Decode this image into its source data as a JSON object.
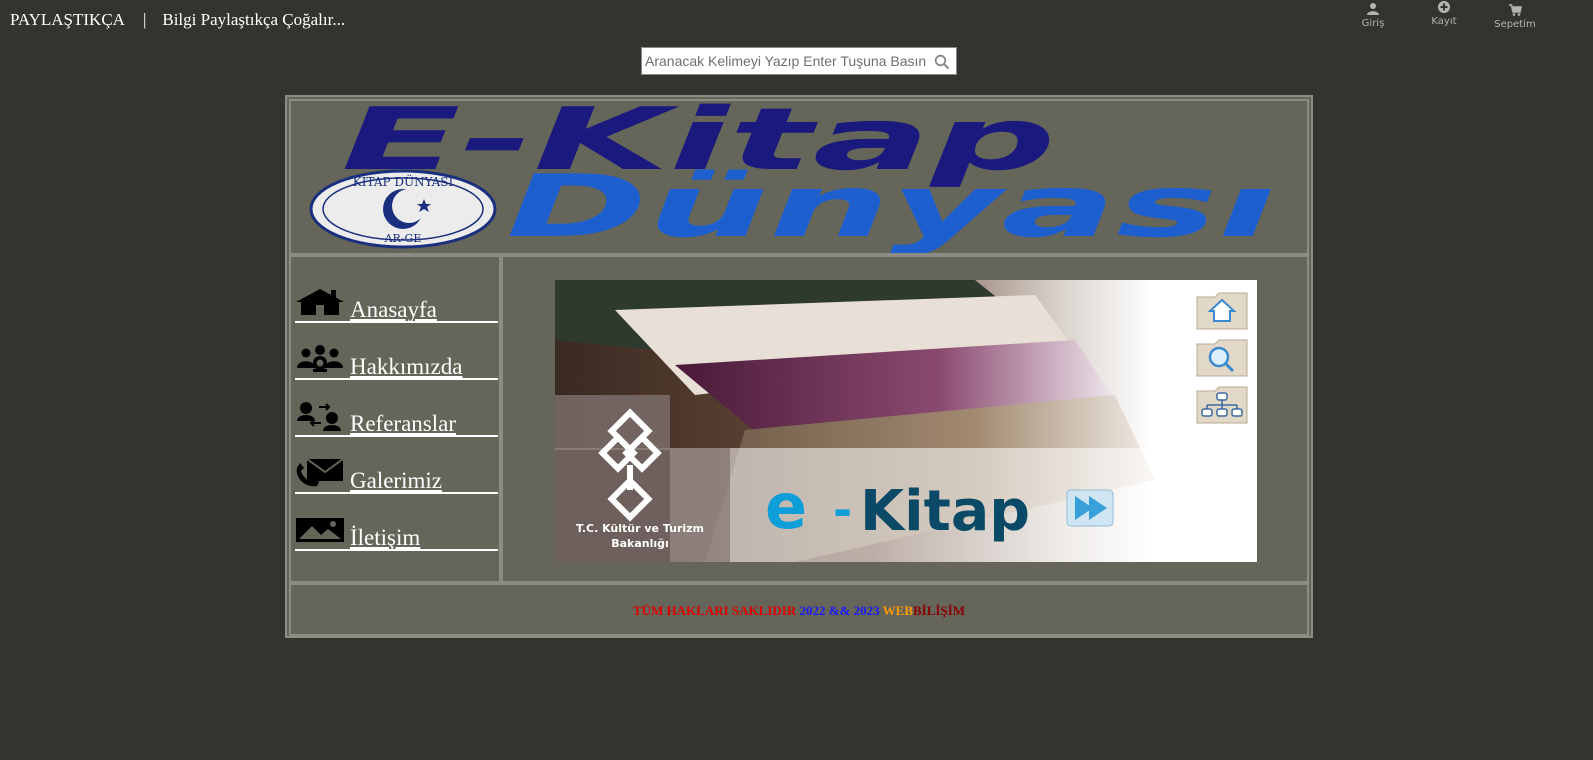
{
  "topbar": {
    "brand": "PAYLAŞTIKÇA",
    "separator": "|",
    "slogan": "Bilgi Paylaştıkça Çoğalır..."
  },
  "account_nav": [
    {
      "label": "Giriş",
      "icon": "user-icon"
    },
    {
      "label": "Kayıt",
      "icon": "plus-circle-icon"
    },
    {
      "label": "Sepetim",
      "icon": "cart-icon"
    }
  ],
  "search": {
    "placeholder": "Aranacak Kelimeyi Yazıp Enter Tuşuna Basınız",
    "icon": "search-icon"
  },
  "banner": {
    "title_line1": "E-Kitap",
    "title_line2": "Dünyası",
    "seal_text_top": "KİTAP DÜNYASI",
    "seal_text_bottom": "AR-GE",
    "title1_color": "#1a1a7e",
    "title2_color": "#1e5fd0"
  },
  "menu": [
    {
      "label": "Anasayfa",
      "icon": "home-icon"
    },
    {
      "label": "Hakkımızda",
      "icon": "group-icon"
    },
    {
      "label": "Referanslar",
      "icon": "people-exchange-icon"
    },
    {
      "label": "Galerimiz",
      "icon": "phone-mail-icon"
    },
    {
      "label": "İletişim",
      "icon": "image-icon"
    }
  ],
  "hero": {
    "ministry_line1": "T.C. Kültür ve Turizm",
    "ministry_line2": "Bakanlığı",
    "brand_e": "e",
    "brand_dash": "-",
    "brand_kitap": "Kitap",
    "buttons": [
      "home-folder-icon",
      "search-folder-icon",
      "sitemap-folder-icon"
    ]
  },
  "footer": {
    "rights": "TÜM HAKLARI SAKLIDIR",
    "years": "2022 && 2023",
    "web": "WEB",
    "bilisim": "BİLİŞİM",
    "colors": {
      "rights": "#e00000",
      "years": "#1a1aff",
      "web": "#ff9900",
      "bilisim": "#8b0000"
    }
  }
}
